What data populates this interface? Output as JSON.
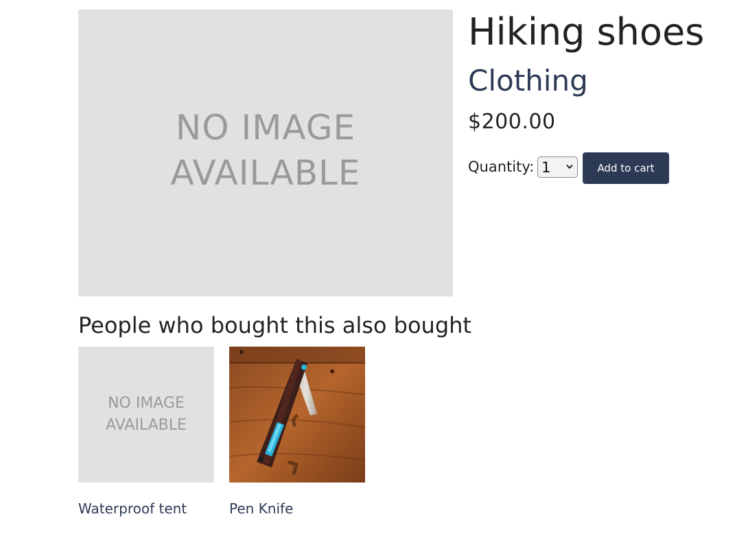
{
  "product": {
    "title": "Hiking shoes",
    "category": "Clothing",
    "price": "$200.00",
    "image_placeholder_line1": "NO IMAGE",
    "image_placeholder_line2": "AVAILABLE"
  },
  "cart": {
    "quantity_label": "Quantity:",
    "quantity_value": "1",
    "add_to_cart_label": "Add to cart"
  },
  "recommendations": {
    "heading": "People who bought this also bought",
    "items": [
      {
        "name": "Waterproof tent",
        "image_placeholder_line1": "NO IMAGE",
        "image_placeholder_line2": "AVAILABLE"
      },
      {
        "name": "Pen Knife"
      }
    ]
  },
  "colors": {
    "accent": "#2d3a55",
    "placeholder_bg": "#e1e1e1",
    "placeholder_text": "#9a9a9a"
  }
}
